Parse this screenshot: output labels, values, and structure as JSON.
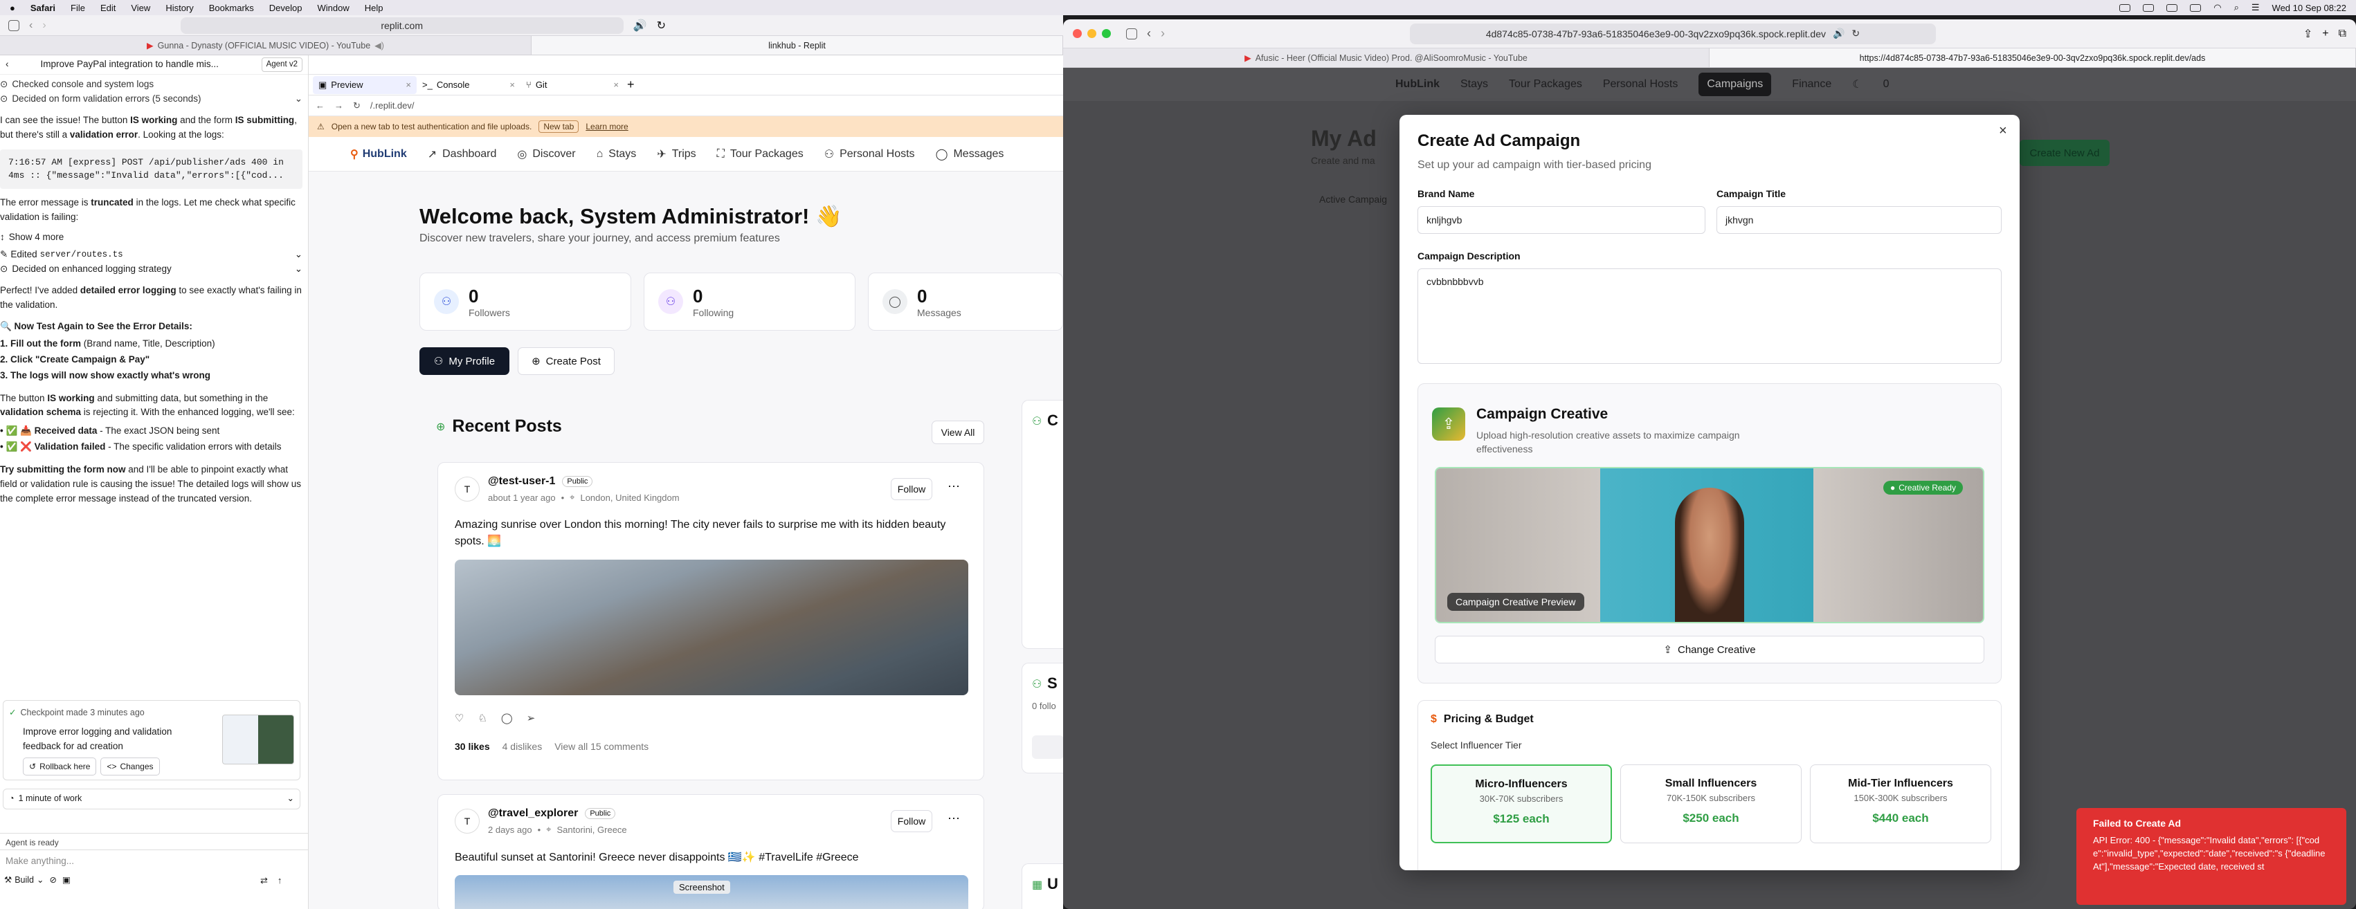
{
  "menubar": {
    "app": "Safari",
    "items": [
      "File",
      "Edit",
      "View",
      "History",
      "Bookmarks",
      "Develop",
      "Window",
      "Help"
    ],
    "datetime": "Wed 10 Sep 08:22"
  },
  "leftwin": {
    "url": "replit.com",
    "tabs": [
      "Gunna - Dynasty (OFFICIAL MUSIC VIDEO) - YouTube",
      "linkhub - Replit"
    ],
    "project": "linkhub"
  },
  "agent": {
    "task": "Improve PayPal integration to handle mis...",
    "agent_badge": "Agent v2",
    "step1": "Checked console and system logs",
    "step2": "Decided on form validation errors (5 seconds)",
    "p1a": "I can see the issue! The button ",
    "p1b": "IS working",
    "p1c": " and the form ",
    "p1d": "IS submitting",
    "p1e": ", but there's still a ",
    "p1f": "validation error",
    "p1g": ". Looking at the logs:",
    "code": "7:16:57 AM [express] POST /api/publisher/ads 400 in 4ms :: {\"message\":\"Invalid data\",\"errors\":[{\"cod...",
    "p2a": "The error message is ",
    "p2b": "truncated",
    "p2c": " in the logs. Let me check what specific validation is failing:",
    "showmore": "Show 4 more",
    "edited": "Edited ",
    "edited_file": "server/routes.ts",
    "decided": "Decided on enhanced logging strategy",
    "p3a": "Perfect! I've added ",
    "p3b": "detailed error logging",
    "p3c": " to see exactly what's failing in the validation.",
    "h_test": "🔍 Now Test Again to See the Error Details:",
    "li1a": "1. Fill out the form",
    "li1b": " (Brand name, Title, Description)",
    "li2": "2. Click \"Create Campaign & Pay\"",
    "li3": "3. The logs will now show exactly what's wrong",
    "p4a": "The button ",
    "p4b": "IS working",
    "p4c": " and submitting data, but something in the ",
    "p4d": "validation schema",
    "p4e": " is rejecting it. With the enhanced logging, we'll see:",
    "b1a": "• ✅ 📥 Received data",
    "b1b": " - The exact JSON being sent",
    "b2a": "• ✅ ❌ Validation failed",
    "b2b": " - The specific validation errors with details",
    "p5a": "Try submitting the form now",
    "p5b": " and I'll be able to pinpoint exactly what field or validation rule is causing the issue! The detailed logs will show us the complete error message instead of the truncated version.",
    "checkpoint": "Checkpoint made 3 minutes ago",
    "checkpoint_title": "Improve error logging and validation feedback for ad creation",
    "rollback": "Rollback here",
    "changes": "Changes",
    "work": "1 minute of work",
    "status": "Agent is ready",
    "placeholder": "Make anything...",
    "mode": "Build"
  },
  "workspace_tabs": [
    "Preview",
    "Console",
    "Git"
  ],
  "preview": {
    "url": "/.replit.dev/",
    "banner": "Open a new tab to test authentication and file uploads.",
    "banner_btn": "New tab",
    "banner_link": "Learn more",
    "brand": "HubLink",
    "nav": [
      "Dashboard",
      "Discover",
      "Stays",
      "Trips",
      "Tour Packages",
      "Personal Hosts",
      "Messages"
    ],
    "welcome": "Welcome back, System Administrator! 👋",
    "subtitle": "Discover new travelers, share your journey, and access premium features",
    "stats": [
      {
        "num": "0",
        "label": "Followers"
      },
      {
        "num": "0",
        "label": "Following"
      },
      {
        "num": "0",
        "label": "Messages"
      }
    ],
    "btn_profile": "My Profile",
    "btn_post": "Create Post",
    "recent": "Recent Posts",
    "view_all": "View All",
    "post1": {
      "user": "@test-user-1",
      "vis": "Public",
      "time": "about 1 year ago",
      "loc": "London, United Kingdom",
      "text": "Amazing sunrise over London this morning! The city never fails to surprise me with its hidden beauty spots. 🌅",
      "likes": "30 likes",
      "dislikes": "4 dislikes",
      "comments": "View all 15 comments",
      "follow": "Follow"
    },
    "post2": {
      "user": "@travel_explorer",
      "vis": "Public",
      "time": "2 days ago",
      "loc": "Santorini, Greece",
      "text": "Beautiful sunset at Santorini! Greece never disappoints 🇬🇷✨ #TravelLife #Greece",
      "follow": "Follow",
      "overlay": "Screenshot"
    },
    "side_c": "C",
    "side_s": "S",
    "side_s2": "0 follo",
    "side_u": "U"
  },
  "rightwin": {
    "url": "4d874c85-0738-47b7-93a6-51835046e3e9-00-3qv2zxo9pq36k.spock.replit.dev",
    "tabs": [
      "Afusic - Heer (Official Music Video) Prod. @AliSoomroMusic - YouTube",
      "https://4d874c85-0738-47b7-93a6-51835046e3e9-00-3qv2zxo9pq36k.spock.replit.dev/ads"
    ],
    "nav": [
      "Stays",
      "Tour Packages",
      "Personal Hosts",
      "Campaigns",
      "Finance"
    ],
    "brand": "HubLink",
    "nav_count": "0",
    "bg_title": "My Ad",
    "bg_sub": "Create and ma",
    "bg_tab": "Active Campaig",
    "bg_btn": "Create New Ad"
  },
  "modal": {
    "title": "Create Ad Campaign",
    "subtitle": "Set up your ad campaign with tier-based pricing",
    "brand_label": "Brand Name",
    "brand_value": "knljhgvb",
    "camp_label": "Campaign Title",
    "camp_value": "jkhvgn",
    "desc_label": "Campaign Description",
    "desc_value": "cvbbnbbbvvb",
    "creative_title": "Campaign Creative",
    "creative_sub": "Upload high-resolution creative assets to maximize campaign effectiveness",
    "ready": "Creative Ready",
    "preview_label": "Campaign Creative Preview",
    "change": "Change Creative",
    "pricing": "Pricing & Budget",
    "select_tier": "Select Influencer Tier",
    "tiers": [
      {
        "name": "Micro-Influencers",
        "range": "30K-70K subscribers",
        "price": "$125 each"
      },
      {
        "name": "Small Influencers",
        "range": "70K-150K subscribers",
        "price": "$250 each"
      },
      {
        "name": "Mid-Tier Influencers",
        "range": "150K-300K subscribers",
        "price": "$440 each"
      }
    ],
    "accent": "#16a34a"
  },
  "toast": {
    "title": "Failed to Create Ad",
    "body": "API Error: 400 - {\"message\":\"Invalid data\",\"errors\": [{\"code\":\"invalid_type\",\"expected\":\"date\",\"received\":\"s {\"deadlineAt\"],\"message\":\"Expected date, received st"
  }
}
